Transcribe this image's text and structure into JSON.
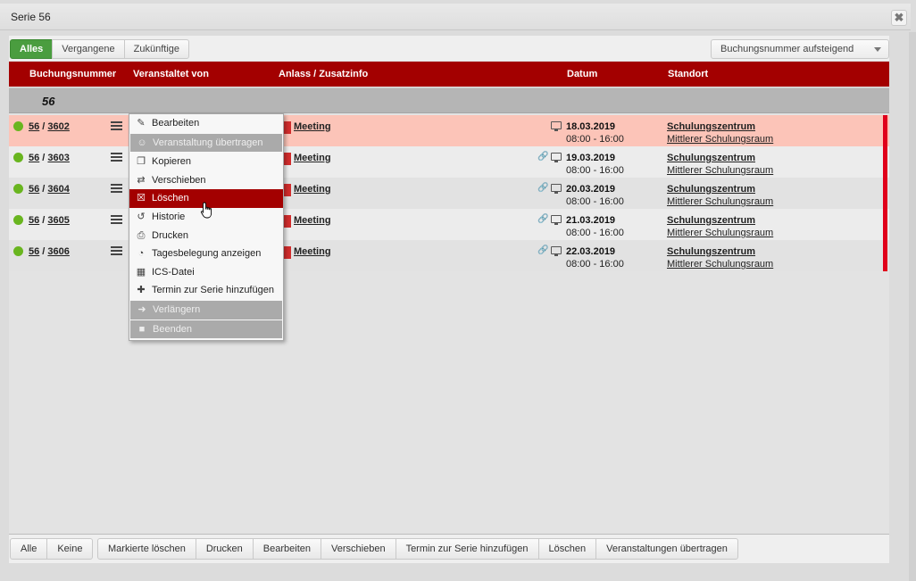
{
  "window": {
    "title": "Serie 56",
    "close_label": "✖"
  },
  "filters": {
    "all": "Alles",
    "past": "Vergangene",
    "future": "Zukünftige"
  },
  "sort": {
    "selected": "Buchungsnummer aufsteigend"
  },
  "columns": {
    "booking": "Buchungsnummer",
    "organizer": "Veranstaltet von",
    "occasion": "Anlass / Zusatzinfo",
    "date": "Datum",
    "location": "Standort"
  },
  "group": {
    "label": "56"
  },
  "rows": [
    {
      "series": "56",
      "sep": " / ",
      "id": "3602",
      "occasion": "Meeting",
      "date": "18.03.2019",
      "time": "08:00 - 16:00",
      "location": "Schulungszentrum",
      "room": "Mittlerer Schulungsraum"
    },
    {
      "series": "56",
      "sep": " / ",
      "id": "3603",
      "occasion": "Meeting",
      "date": "19.03.2019",
      "time": "08:00 - 16:00",
      "location": "Schulungszentrum",
      "room": "Mittlerer Schulungsraum"
    },
    {
      "series": "56",
      "sep": " / ",
      "id": "3604",
      "occasion": "Meeting",
      "date": "20.03.2019",
      "time": "08:00 - 16:00",
      "location": "Schulungszentrum",
      "room": "Mittlerer Schulungsraum"
    },
    {
      "series": "56",
      "sep": " / ",
      "id": "3605",
      "occasion": "Meeting",
      "date": "21.03.2019",
      "time": "08:00 - 16:00",
      "location": "Schulungszentrum",
      "room": "Mittlerer Schulungsraum"
    },
    {
      "series": "56",
      "sep": " / ",
      "id": "3606",
      "occasion": "Meeting",
      "date": "22.03.2019",
      "time": "08:00 - 16:00",
      "location": "Schulungszentrum",
      "room": "Mittlerer Schulungsraum"
    }
  ],
  "context_menu": {
    "edit": "Bearbeiten",
    "transfer": "Veranstaltung übertragen",
    "copy": "Kopieren",
    "move": "Verschieben",
    "delete": "Löschen",
    "history": "Historie",
    "print": "Drucken",
    "day_view": "Tagesbelegung anzeigen",
    "ics": "ICS-Datei",
    "add_to_series": "Termin zur Serie hinzufügen",
    "extend": "Verlängern",
    "end": "Beenden"
  },
  "footer": {
    "all": "Alle",
    "none": "Keine",
    "delete_marked": "Markierte löschen",
    "print": "Drucken",
    "edit": "Bearbeiten",
    "move": "Verschieben",
    "add_to_series": "Termin zur Serie hinzufügen",
    "delete": "Löschen",
    "transfer": "Veranstaltungen übertragen"
  },
  "colors": {
    "header_red": "#a30000",
    "active_green": "#4a9d3f",
    "status_green": "#69b51f",
    "highlight_row": "#fcc4b8",
    "side_bar": "#e0001b"
  }
}
